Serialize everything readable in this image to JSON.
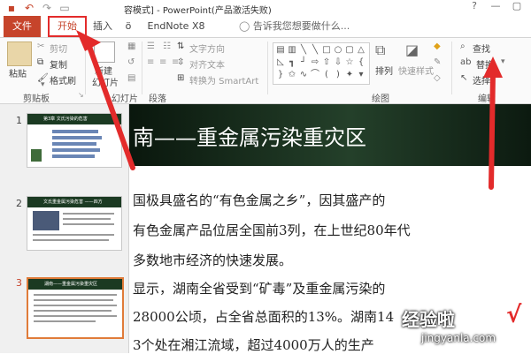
{
  "window": {
    "title": "容模式] - PowerPoint(产品激活失败)",
    "help_label": "?",
    "minimize_label": "—",
    "restore_label": "▢"
  },
  "tabs": [
    {
      "label": "文件"
    },
    {
      "label": "开始"
    },
    {
      "label": "插入"
    },
    {
      "label": "ö"
    },
    {
      "label": "EndNote X8"
    }
  ],
  "tell_me": "告诉我您想要做什么...",
  "ribbon": {
    "clipboard": {
      "paste": "粘贴",
      "cut": "剪切",
      "copy": "复制",
      "format_painter": "格式刷",
      "group_label": "剪贴板"
    },
    "slides": {
      "new_slide_line1": "新建",
      "new_slide_line2": "幻灯片",
      "group_label": "幻灯片"
    },
    "paragraph": {
      "text_direction": "文字方向",
      "align_text": "对齐文本",
      "convert_smartart": "转换为 SmartArt",
      "group_label": "段落"
    },
    "drawing": {
      "arrange": "排列",
      "quick_styles": "快速样式",
      "group_label": "绘图"
    },
    "editing": {
      "find": "查找",
      "replace": "替换",
      "select": "选择",
      "group_label": "编辑"
    }
  },
  "thumbnails": [
    {
      "number": "1",
      "header": "第3章  文氏污染的危害",
      "bar_count": 5
    },
    {
      "number": "2",
      "header": "文氏重金属污染危害 ——四方",
      "bar_count": 0
    },
    {
      "number": "3",
      "header": "湖南——重金属污染重灾区",
      "bar_count": 0
    }
  ],
  "slide": {
    "title": "南——重金属污染重灾区",
    "lines": [
      "国极具盛名的“有色金属之乡”，因其盛产的",
      "有色金属产品位居全国前3列，在上世纪80年代",
      "多数地市经济的快速发展。",
      "显示，湖南全省受到“矿毒”及重金属污染的",
      "28000公顷，占全省总面积的13%。湖南14",
      "3个处在湘江流域，超过4000万人的生产"
    ]
  },
  "watermark": {
    "main": "经验啦",
    "check": "√",
    "url": "jingyanla.com"
  },
  "colors": {
    "file_tab": "#c6442b",
    "highlight": "#e32b2b",
    "slide_header": "#1b3a22"
  }
}
